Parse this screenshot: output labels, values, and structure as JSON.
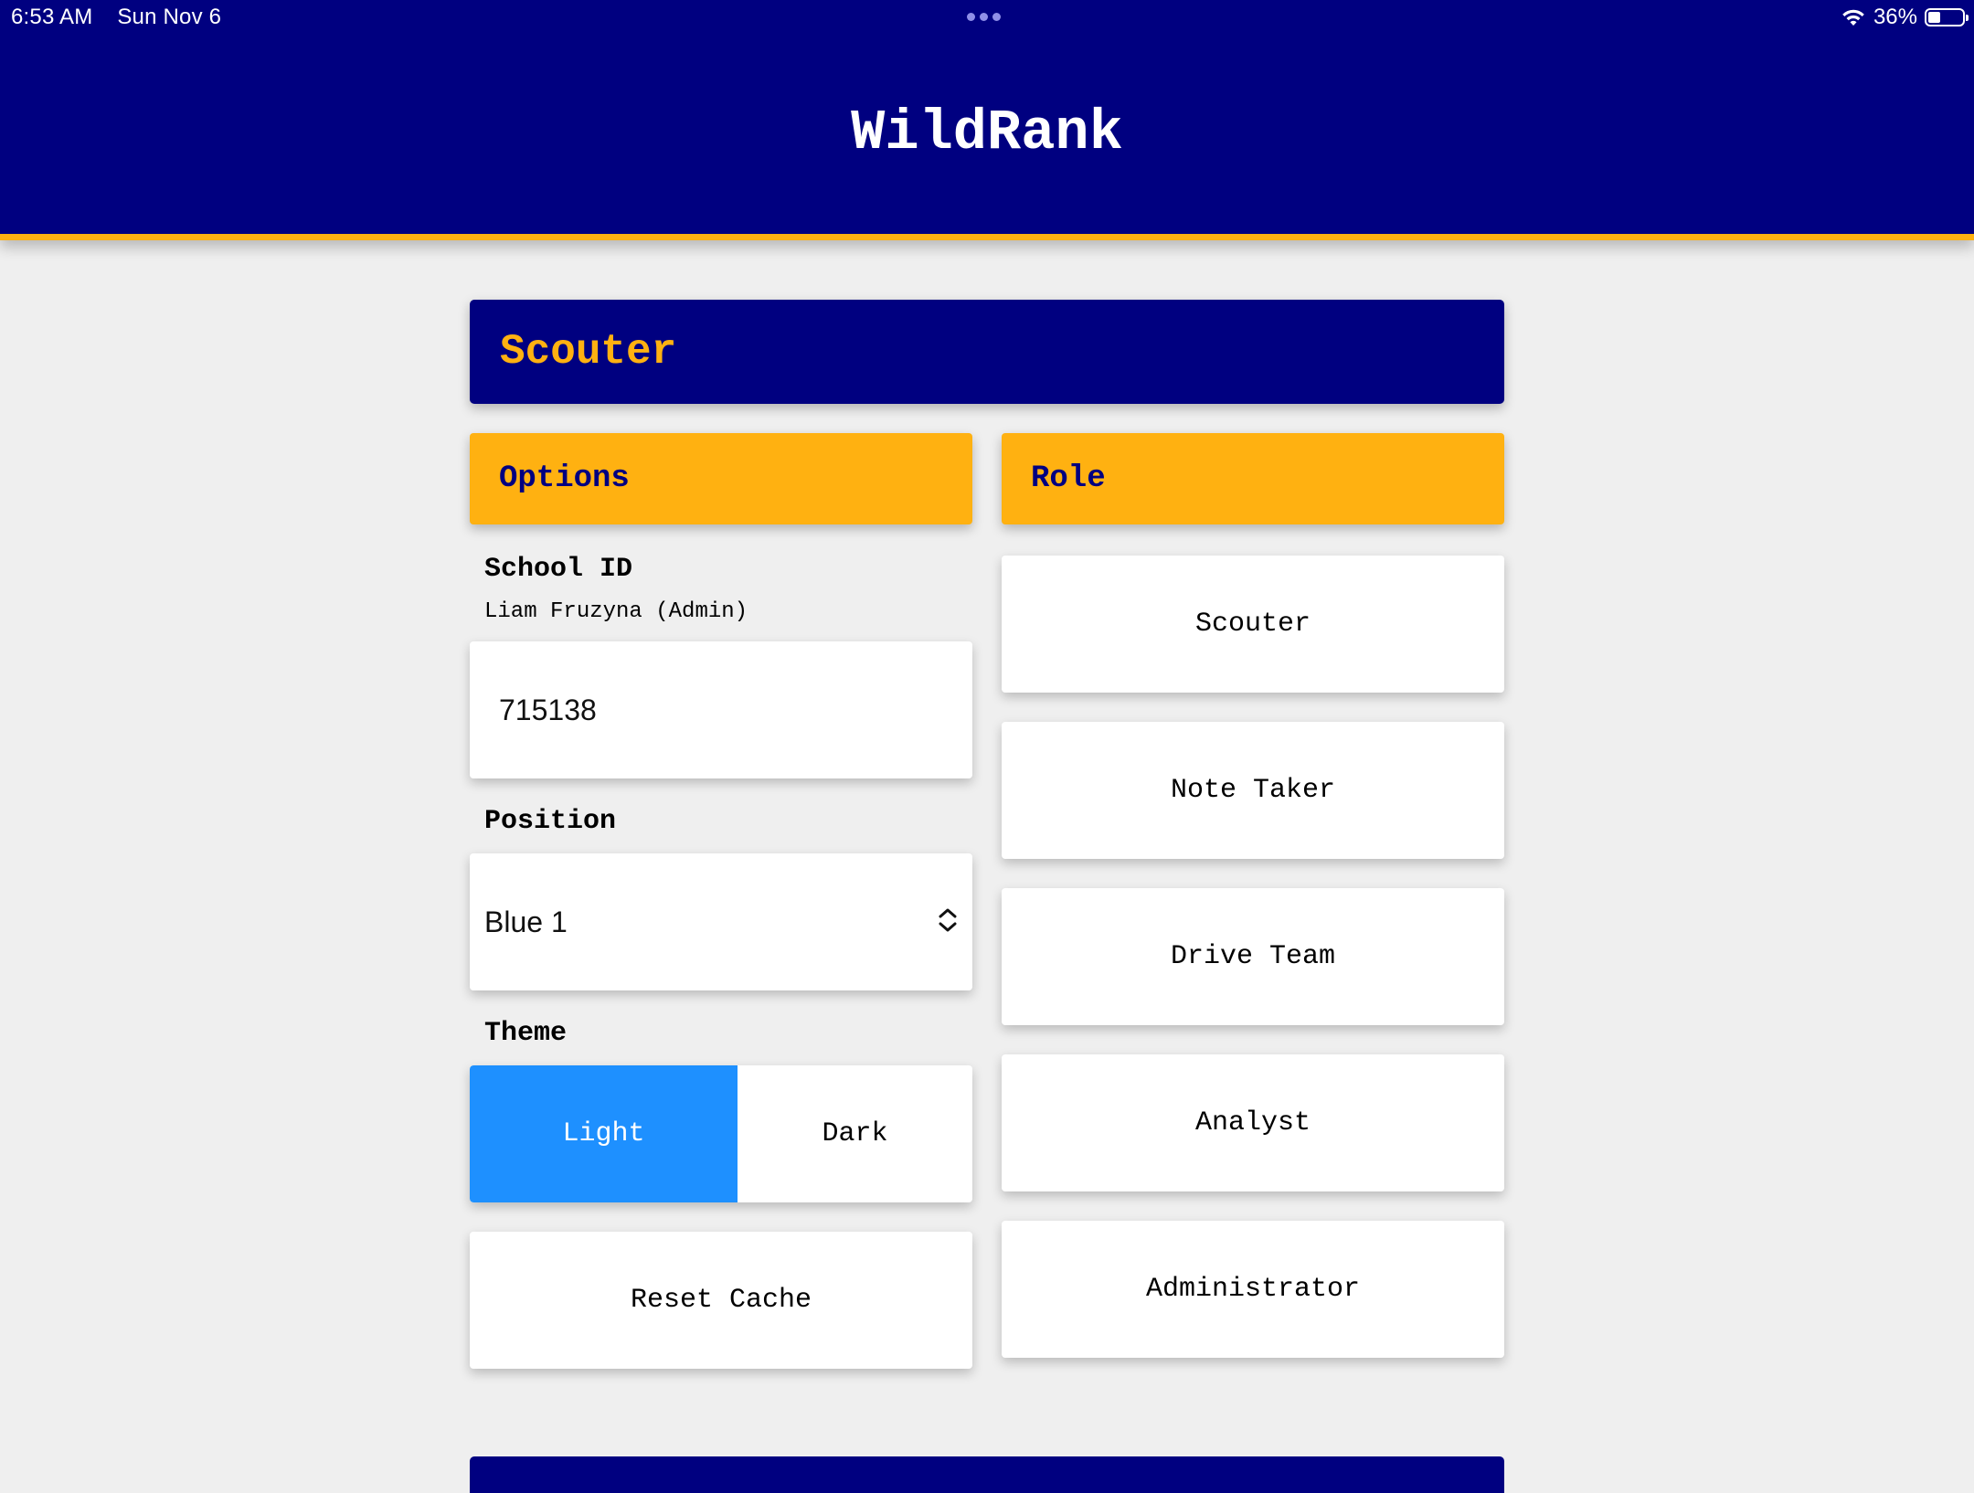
{
  "status_bar": {
    "time": "6:53 AM",
    "date": "Sun Nov 6",
    "battery_percent": "36%",
    "battery_level": 0.36,
    "icons": [
      "multitasking-dots-icon",
      "wifi-icon",
      "battery-icon"
    ]
  },
  "header": {
    "title": "WildRank"
  },
  "page": {
    "banner_title": "Scouter"
  },
  "options": {
    "header": "Options",
    "school_id_label": "School ID",
    "user_name": "Liam Fruzyna (Admin)",
    "school_id_value": "715138",
    "position_label": "Position",
    "position_selected": "Blue 1",
    "theme_label": "Theme",
    "theme_options": [
      "Light",
      "Dark"
    ],
    "theme_selected": "Light",
    "reset_cache_label": "Reset Cache"
  },
  "role": {
    "header": "Role",
    "buttons": [
      "Scouter",
      "Note Taker",
      "Drive Team",
      "Analyst",
      "Administrator"
    ]
  },
  "colors": {
    "primary": "#000080",
    "accent": "#ffb111",
    "selected": "#1e90ff",
    "background": "#efefef",
    "surface": "#ffffff"
  }
}
